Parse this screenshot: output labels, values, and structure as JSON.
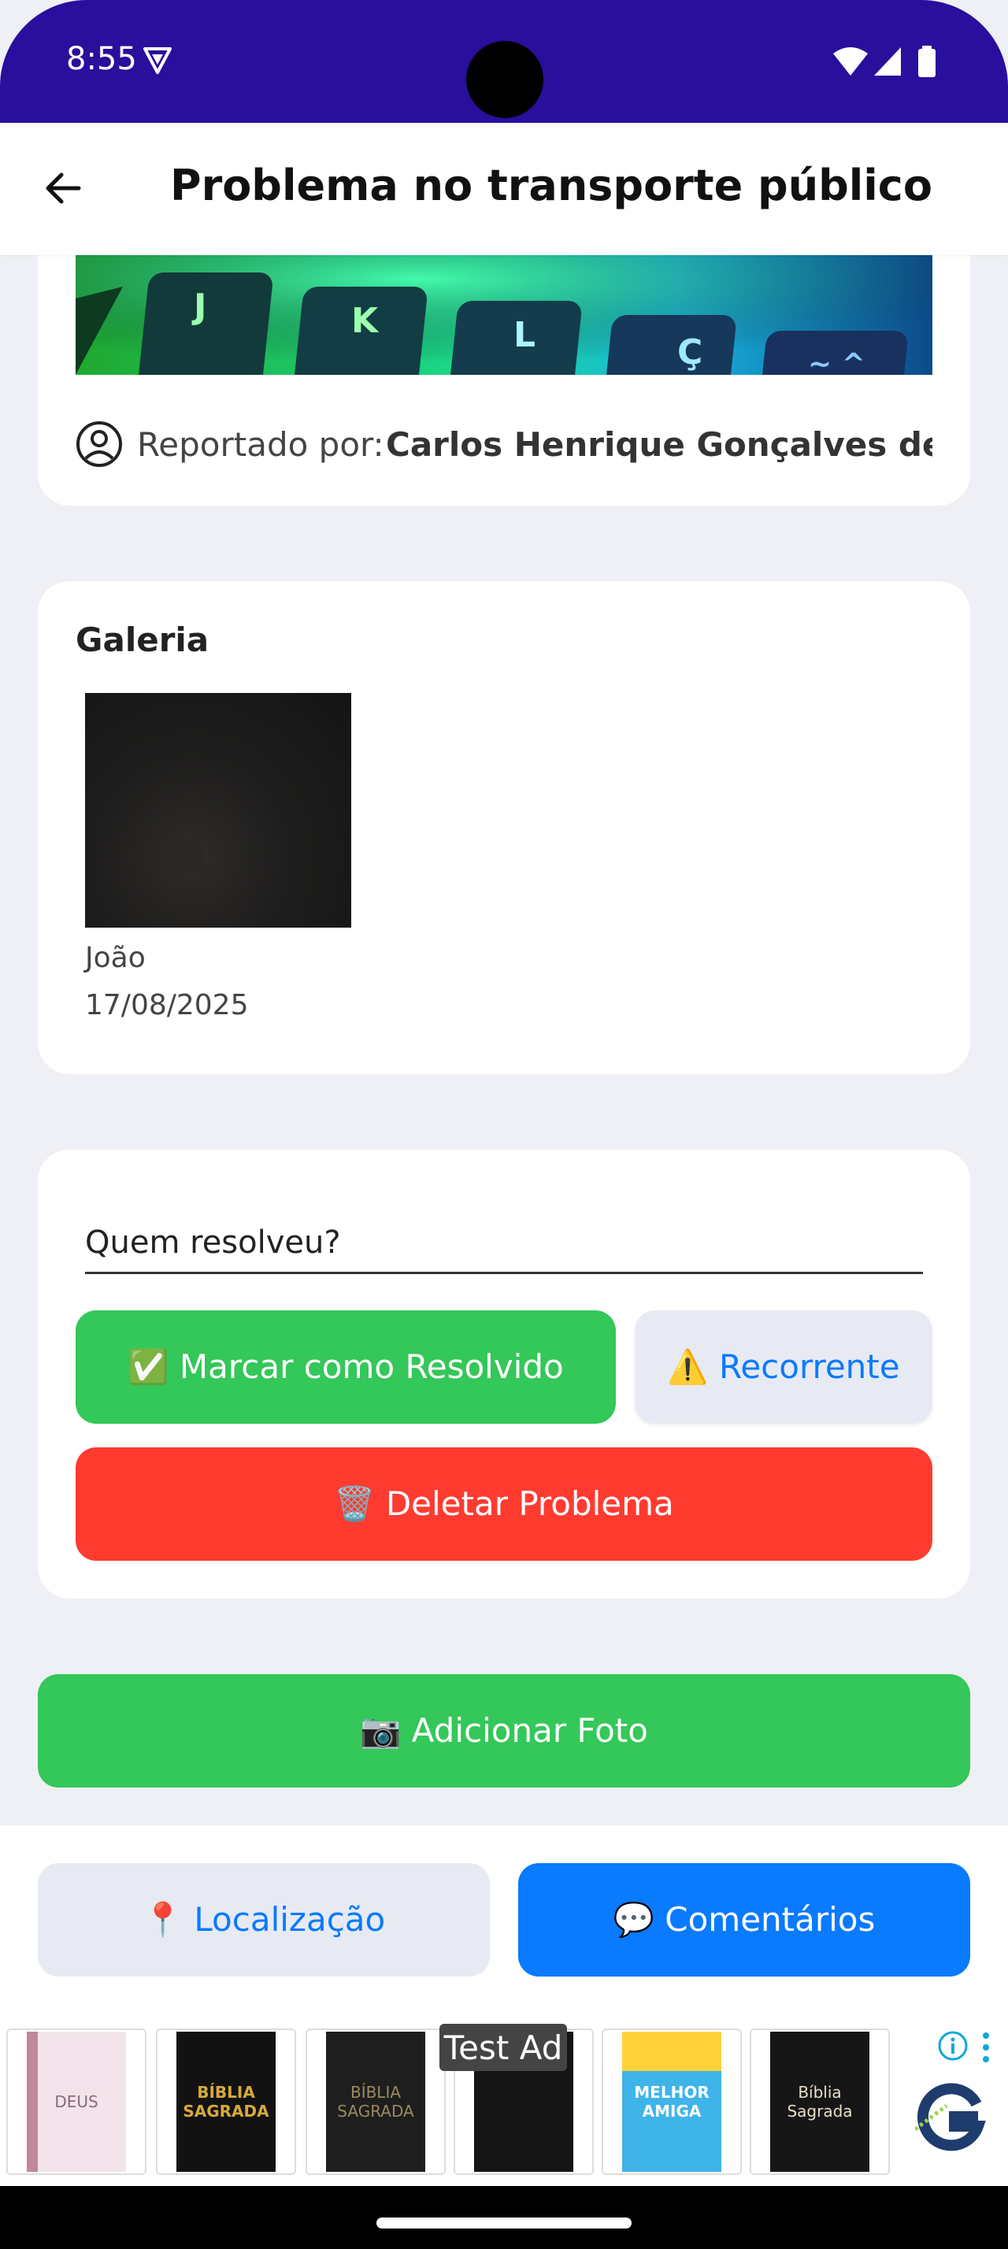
{
  "status_bar": {
    "time": "8:55",
    "icons": [
      "vpn-icon",
      "wifi-icon",
      "signal-icon",
      "battery-icon"
    ]
  },
  "app_bar": {
    "title": "Problema no transporte público",
    "back_icon": "arrow-left-icon"
  },
  "reporter_card": {
    "reported_label": "Reportado por:",
    "reporter_name": "Carlos Henrique Gonçalves de Araújo",
    "key_letters": [
      "J",
      "K",
      "L",
      "Ç",
      "~ ^"
    ]
  },
  "gallery": {
    "title": "Galeria",
    "photos": [
      {
        "author": "João",
        "date": "17/08/2025"
      }
    ]
  },
  "resolve_card": {
    "resolver_placeholder": "Quem resolveu?",
    "resolved_label": "✅ Marcar como Resolvido",
    "recurring_label": "⚠️ Recorrente",
    "delete_label": "🗑️ Deletar Problema"
  },
  "add_photo_label": "📷 Adicionar Foto",
  "bottom_actions": {
    "location_label": "📍 Localização",
    "comments_label": "💬 Comentários"
  },
  "ad": {
    "label": "Test Ad",
    "items": [
      "DEUS",
      "BÍBLIA SAGRADA",
      "BÍBLIA SAGRADA",
      "",
      "MELHOR AMIGA",
      "Bíblia Sagrada"
    ]
  },
  "colors": {
    "status_bar": "#2a0e9c",
    "green": "#34c759",
    "red": "#ff3b30",
    "blue": "#0a7aff",
    "light_button": "#e7eaf3",
    "background": "#eff0f5"
  }
}
